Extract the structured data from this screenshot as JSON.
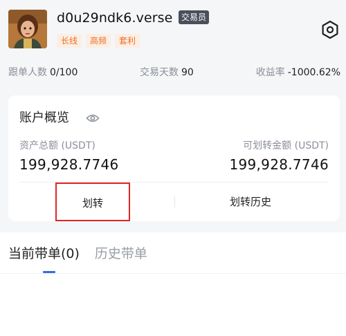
{
  "profile": {
    "username": "d0u29ndk6.verse",
    "badge": "交易员",
    "tags": [
      "长线",
      "高频",
      "套利"
    ]
  },
  "stats": {
    "followers_label": "跟单人数",
    "followers_value": "0/100",
    "days_label": "交易天数",
    "days_value": "90",
    "yield_label": "收益率",
    "yield_value": "-1000.62%"
  },
  "account": {
    "title": "账户概览",
    "total_label": "资产总额 (USDT)",
    "total_value": "199,928.7746",
    "transferable_label": "可划转金额 (USDT)",
    "transferable_value": "199,928.7746",
    "transfer_button": "划转",
    "history_button": "划转历史"
  },
  "tabs": [
    {
      "label": "当前带单(0)",
      "active": true
    },
    {
      "label": "历史带单",
      "active": false
    }
  ],
  "colors": {
    "accent": "#2f6fed",
    "tag_text": "#e8722a",
    "tag_bg": "#fdeee3",
    "highlight_border": "#e02424"
  },
  "icons": {
    "settings": "hexagon-settings-icon",
    "eye": "eye-icon"
  }
}
